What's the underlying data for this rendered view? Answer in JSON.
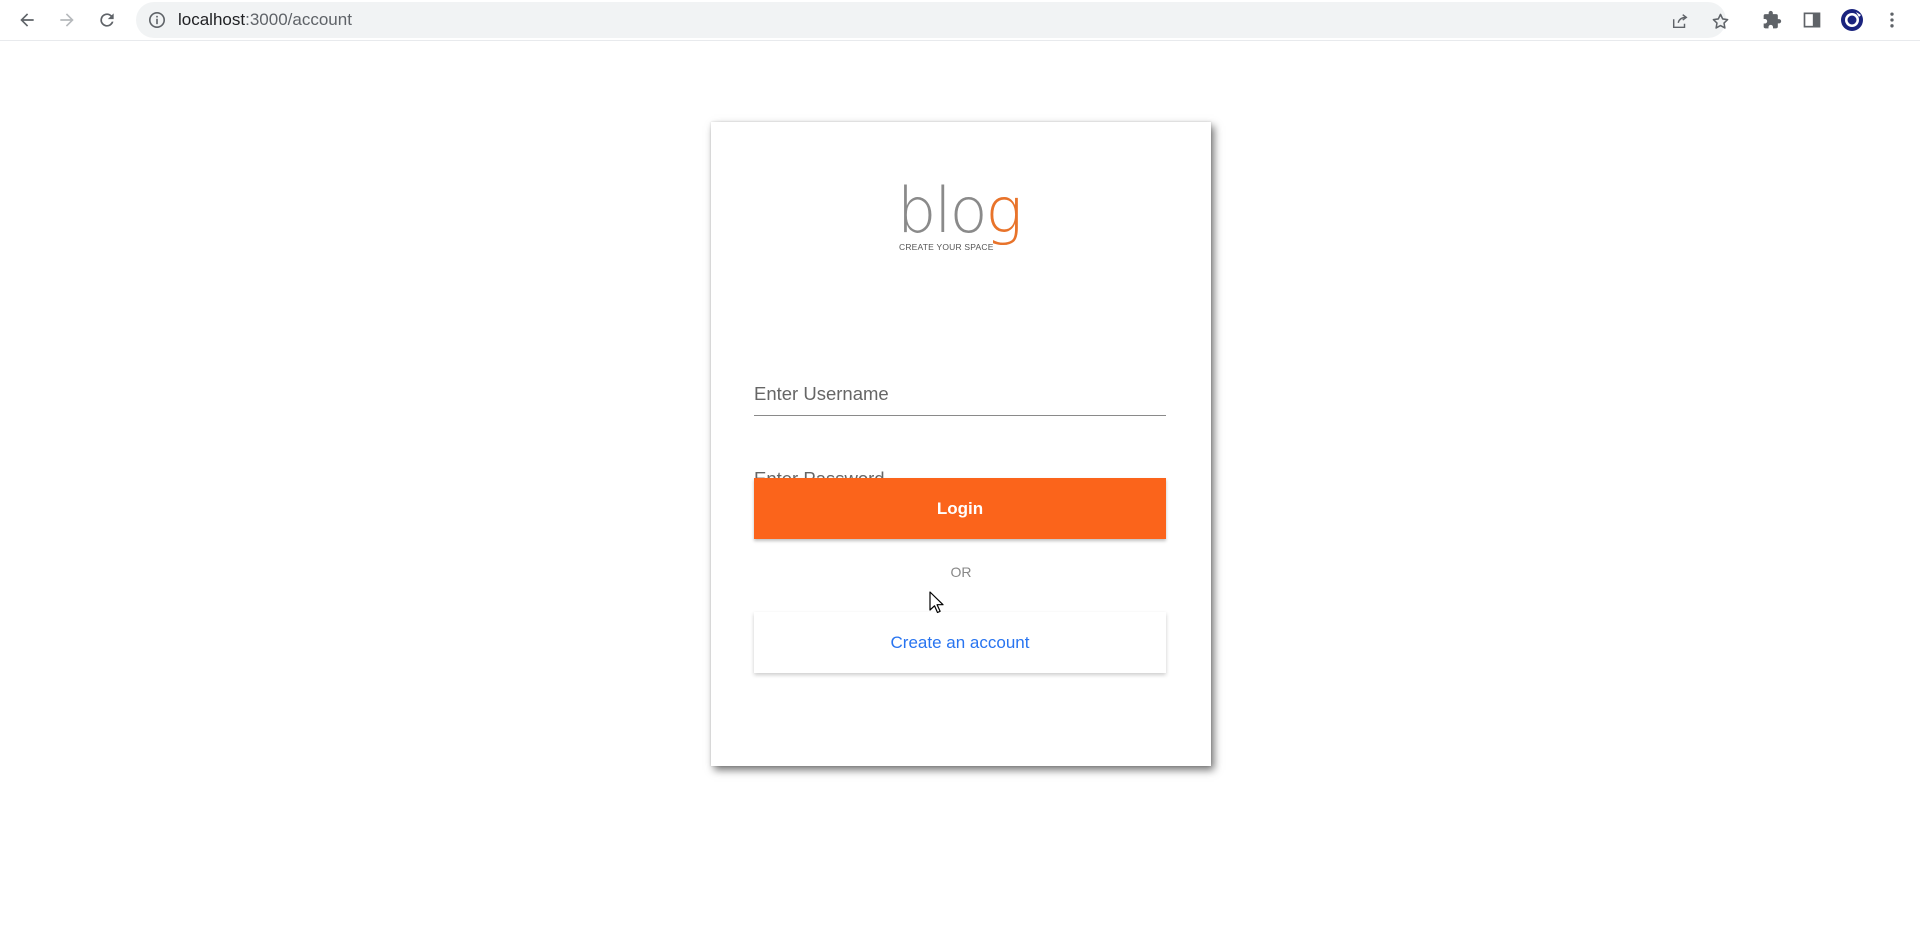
{
  "browser": {
    "url_host": "localhost",
    "url_path": ":3000/account",
    "icons": {
      "back": "arrow-left-icon",
      "forward": "arrow-right-icon",
      "reload": "reload-icon",
      "site_info": "info-icon",
      "share": "share-icon",
      "bookmark": "star-icon",
      "extensions": "puzzle-icon",
      "side_panel": "side-panel-icon",
      "profile": "profile-avatar-icon",
      "menu": "kebab-menu-icon"
    }
  },
  "login_card": {
    "logo": {
      "word_main": "blo",
      "word_accent": "g",
      "tagline": "CREATE YOUR SPACE"
    },
    "username_placeholder": "Enter Username",
    "password_placeholder": "Enter Password",
    "login_label": "Login",
    "or_label": "OR",
    "create_account_label": "Create an account"
  },
  "colors": {
    "login_button": "#fb641b",
    "create_account_text": "#2874f0",
    "logo_accent": "#e8732a",
    "logo_gray": "#8a8a8a"
  }
}
